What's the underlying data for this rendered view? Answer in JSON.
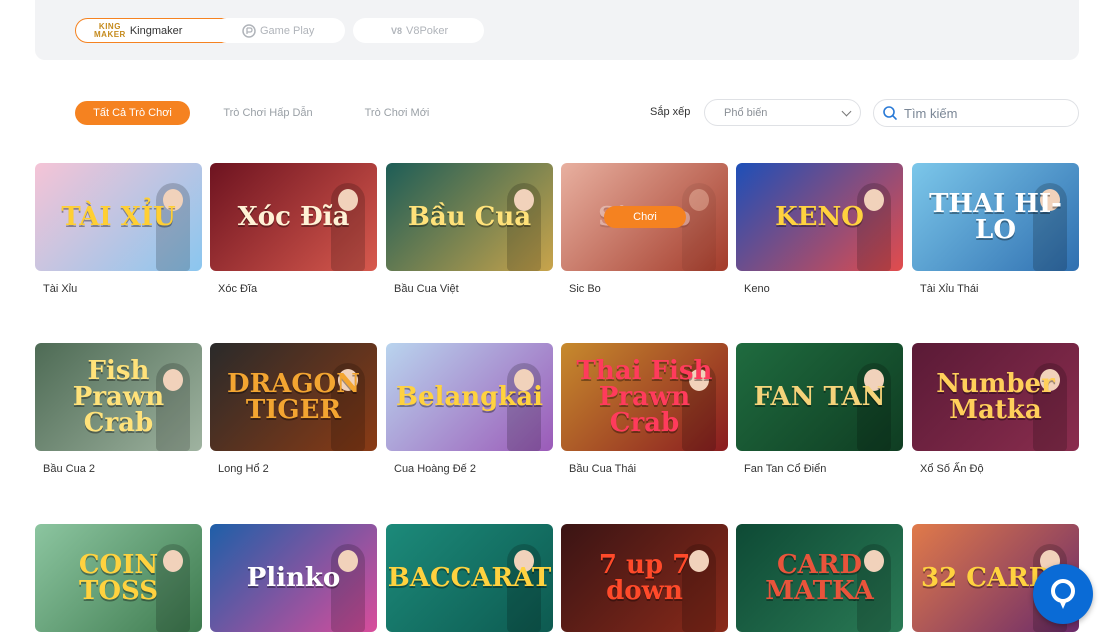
{
  "providers": [
    {
      "label": "Kingmaker",
      "logo_text_top": "KING",
      "logo_text_bottom": "MAKER",
      "active": true
    },
    {
      "label": "Game Play",
      "logo_icon": "gameplay-logo-icon",
      "active": false
    },
    {
      "label": "V8Poker",
      "logo_text": "V8",
      "active": false
    }
  ],
  "tabs": [
    {
      "label": "Tất Cả Trò Chơi",
      "active": true
    },
    {
      "label": "Trò Chơi Hấp Dẫn",
      "active": false
    },
    {
      "label": "Trò Chơi Mới",
      "active": false
    }
  ],
  "sort": {
    "label": "Sắp xếp",
    "selected": "Phổ biến"
  },
  "search": {
    "placeholder": "Tìm kiếm",
    "value": ""
  },
  "hover_play_label": "Chơi",
  "games": [
    {
      "name": "Tài Xỉu",
      "art_text": "TÀI XỈU",
      "bg": "linear-gradient(135deg,#f5c4d6,#8ac6ef)",
      "art_color": "#ffcf33"
    },
    {
      "name": "Xóc Đĩa",
      "art_text": "Xóc Đĩa",
      "bg": "linear-gradient(135deg,#6d1320,#d85a4e)",
      "art_color": "#fff2d6"
    },
    {
      "name": "Bầu Cua Việt",
      "art_text": "Bầu Cua",
      "bg": "linear-gradient(135deg,#1d5d57,#c9a44b)",
      "art_color": "#ffe27a"
    },
    {
      "name": "Sic Bo",
      "art_text": "Sic Bo",
      "bg": "linear-gradient(135deg,#e8b0a0,#a33b2a)",
      "art_color": "#ffffff",
      "hovered": true
    },
    {
      "name": "Keno",
      "art_text": "KENO",
      "bg": "linear-gradient(135deg,#1d4fb8,#e24c4c)",
      "art_color": "#ffd23f"
    },
    {
      "name": "Tài Xỉu Thái",
      "art_text": "THAI HI-LO",
      "bg": "linear-gradient(135deg,#7cc7ea,#2f6fb0)",
      "art_color": "#ffffff"
    },
    {
      "name": "Bầu Cua 2",
      "art_text": "Fish Prawn Crab",
      "bg": "linear-gradient(135deg,#4e6b55,#9fb3a0)",
      "art_color": "#ffe27a"
    },
    {
      "name": "Long Hổ 2",
      "art_text": "DRAGON TIGER",
      "bg": "linear-gradient(135deg,#2a2a2a,#8a3b15)",
      "art_color": "#f3a531"
    },
    {
      "name": "Cua Hoàng Đế 2",
      "art_text": "Belangkai",
      "bg": "linear-gradient(135deg,#b9d4ee,#9b5ab8)",
      "art_color": "#ffd23f"
    },
    {
      "name": "Bầu Cua Thái",
      "art_text": "Thai Fish Prawn Crab",
      "bg": "linear-gradient(135deg,#c78a2d,#8a1c20)",
      "art_color": "#ff3b5c"
    },
    {
      "name": "Fan Tan Cổ Điển",
      "art_text": "FAN TAN",
      "bg": "linear-gradient(135deg,#1f6b3f,#0f3d22)",
      "art_color": "#f5d37a"
    },
    {
      "name": "Xổ Số Ấn Độ",
      "art_text": "Number Matka",
      "bg": "linear-gradient(135deg,#5a1a36,#8a2d4e)",
      "art_color": "#ffcf5a"
    },
    {
      "name": "",
      "art_text": "COIN TOSS",
      "bg": "linear-gradient(135deg,#8cc5a0,#3d7a4e)",
      "art_color": "#ffd23f"
    },
    {
      "name": "",
      "art_text": "Plinko",
      "bg": "linear-gradient(135deg,#1e5fa8,#d94d9b)",
      "art_color": "#ffffff"
    },
    {
      "name": "",
      "art_text": "BACCARAT",
      "bg": "linear-gradient(135deg,#1c8a7a,#0d5a50)",
      "art_color": "#ffd23f"
    },
    {
      "name": "",
      "art_text": "7 up 7 down",
      "bg": "linear-gradient(135deg,#3a1414,#8a2a1a)",
      "art_color": "#ff4a2a"
    },
    {
      "name": "",
      "art_text": "CARD MATKA",
      "bg": "linear-gradient(135deg,#0e4a35,#2a7a55)",
      "art_color": "#e9543b"
    },
    {
      "name": "",
      "art_text": "32 CARDS",
      "bg": "linear-gradient(135deg,#e07a4a,#6a2a6a)",
      "art_color": "#ffd23f"
    }
  ],
  "colors": {
    "accent": "#f58220",
    "chat": "#0a6bd6"
  },
  "chat_widget_icon": "chat-icon"
}
